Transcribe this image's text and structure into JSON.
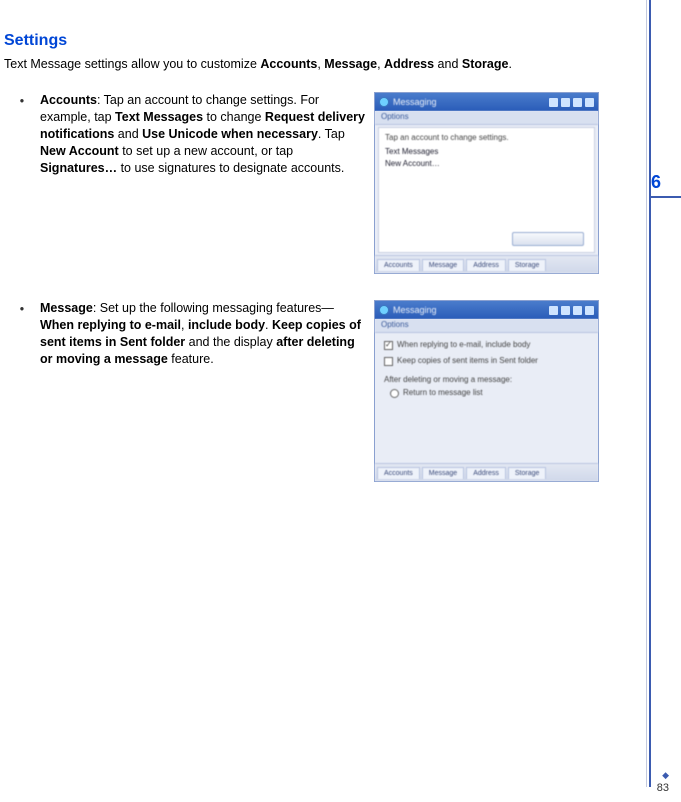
{
  "heading": "Settings",
  "intro": {
    "prefix": "Text Message settings allow you to customize ",
    "b1": "Accounts",
    "sep1": ", ",
    "b2": "Message",
    "sep2": ", ",
    "b3": "Address",
    "sep3": " and ",
    "b4": "Storage",
    "suffix": "."
  },
  "bullet": "•",
  "accounts": {
    "b1": "Accounts",
    "t1": ": Tap an account to change settings. For example, tap ",
    "b2": "Text Messages",
    "t2": " to change ",
    "b3": "Request delivery notifications",
    "t3": " and ",
    "b4": "Use Unicode when necessary",
    "t4": ". Tap ",
    "b5": "New Account",
    "t5": " to set up a new account, or tap ",
    "b6": "Signatures…",
    "t6": " to use signatures to designate accounts."
  },
  "message": {
    "b1": "Message",
    "t1": ": Set up the following messaging features—",
    "b2": "When replying to e-mail",
    "t2": ", ",
    "b3": "include body",
    "t3": ". ",
    "b4": "Keep copies of sent items in Sent folder",
    "t4": " and the display ",
    "b5": "after deleting or moving a message",
    "t5": " feature."
  },
  "shot1": {
    "title": "Messaging",
    "sub": "Options",
    "line1": "Tap an account to change settings.",
    "line2": "Text Messages",
    "line3": "New Account…",
    "tabs": [
      "Accounts",
      "Message",
      "Address",
      "Storage"
    ]
  },
  "shot2": {
    "title": "Messaging",
    "sub": "Options",
    "l1": "When replying to e-mail, include body",
    "l2": "Keep copies of sent items in Sent folder",
    "l3": "After deleting or moving a message:",
    "l4": "Return to message list",
    "tabs": [
      "Accounts",
      "Message",
      "Address",
      "Storage"
    ]
  },
  "chapter": "6",
  "pagenum": "83"
}
